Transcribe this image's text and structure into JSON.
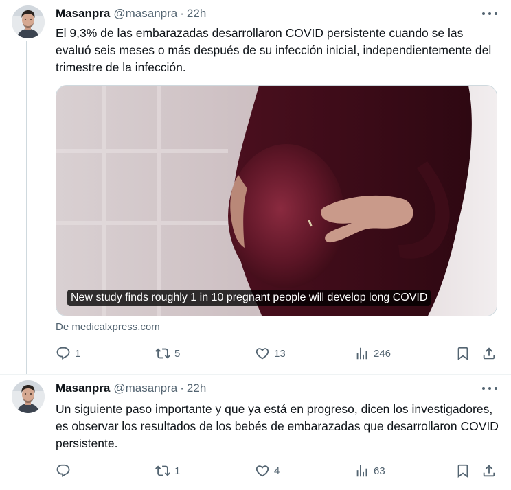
{
  "tweets": [
    {
      "name": "Masanpra",
      "handle": "@masanpra",
      "separator": "·",
      "time": "22h",
      "text": "El 9,3% de las embarazadas desarrollaron COVID persistente cuando se las evaluó seis meses o más después de su infección inicial, independientemente del trimestre de la infección.",
      "card": {
        "caption": "New study finds roughly 1 in 10 pregnant people will develop long COVID",
        "source": "De medicalxpress.com"
      },
      "replies": "1",
      "retweets": "5",
      "likes": "13",
      "views": "246"
    },
    {
      "name": "Masanpra",
      "handle": "@masanpra",
      "separator": "·",
      "time": "22h",
      "text": "Un siguiente paso importante y que ya está en progreso, dicen los investigadores, es observar los resultados de los bebés de embarazadas que desarrollaron COVID persistente.",
      "replies": "",
      "retweets": "1",
      "likes": "4",
      "views": "63"
    }
  ],
  "icons": {
    "more": "more-horizontal-icon",
    "reply": "reply-icon",
    "retweet": "retweet-icon",
    "like": "heart-icon",
    "views": "views-chart-icon",
    "bookmark": "bookmark-icon",
    "share": "share-icon"
  },
  "colors": {
    "text": "#0f1419",
    "secondary": "#536471",
    "border": "#cfd9de",
    "background": "#ffffff"
  }
}
